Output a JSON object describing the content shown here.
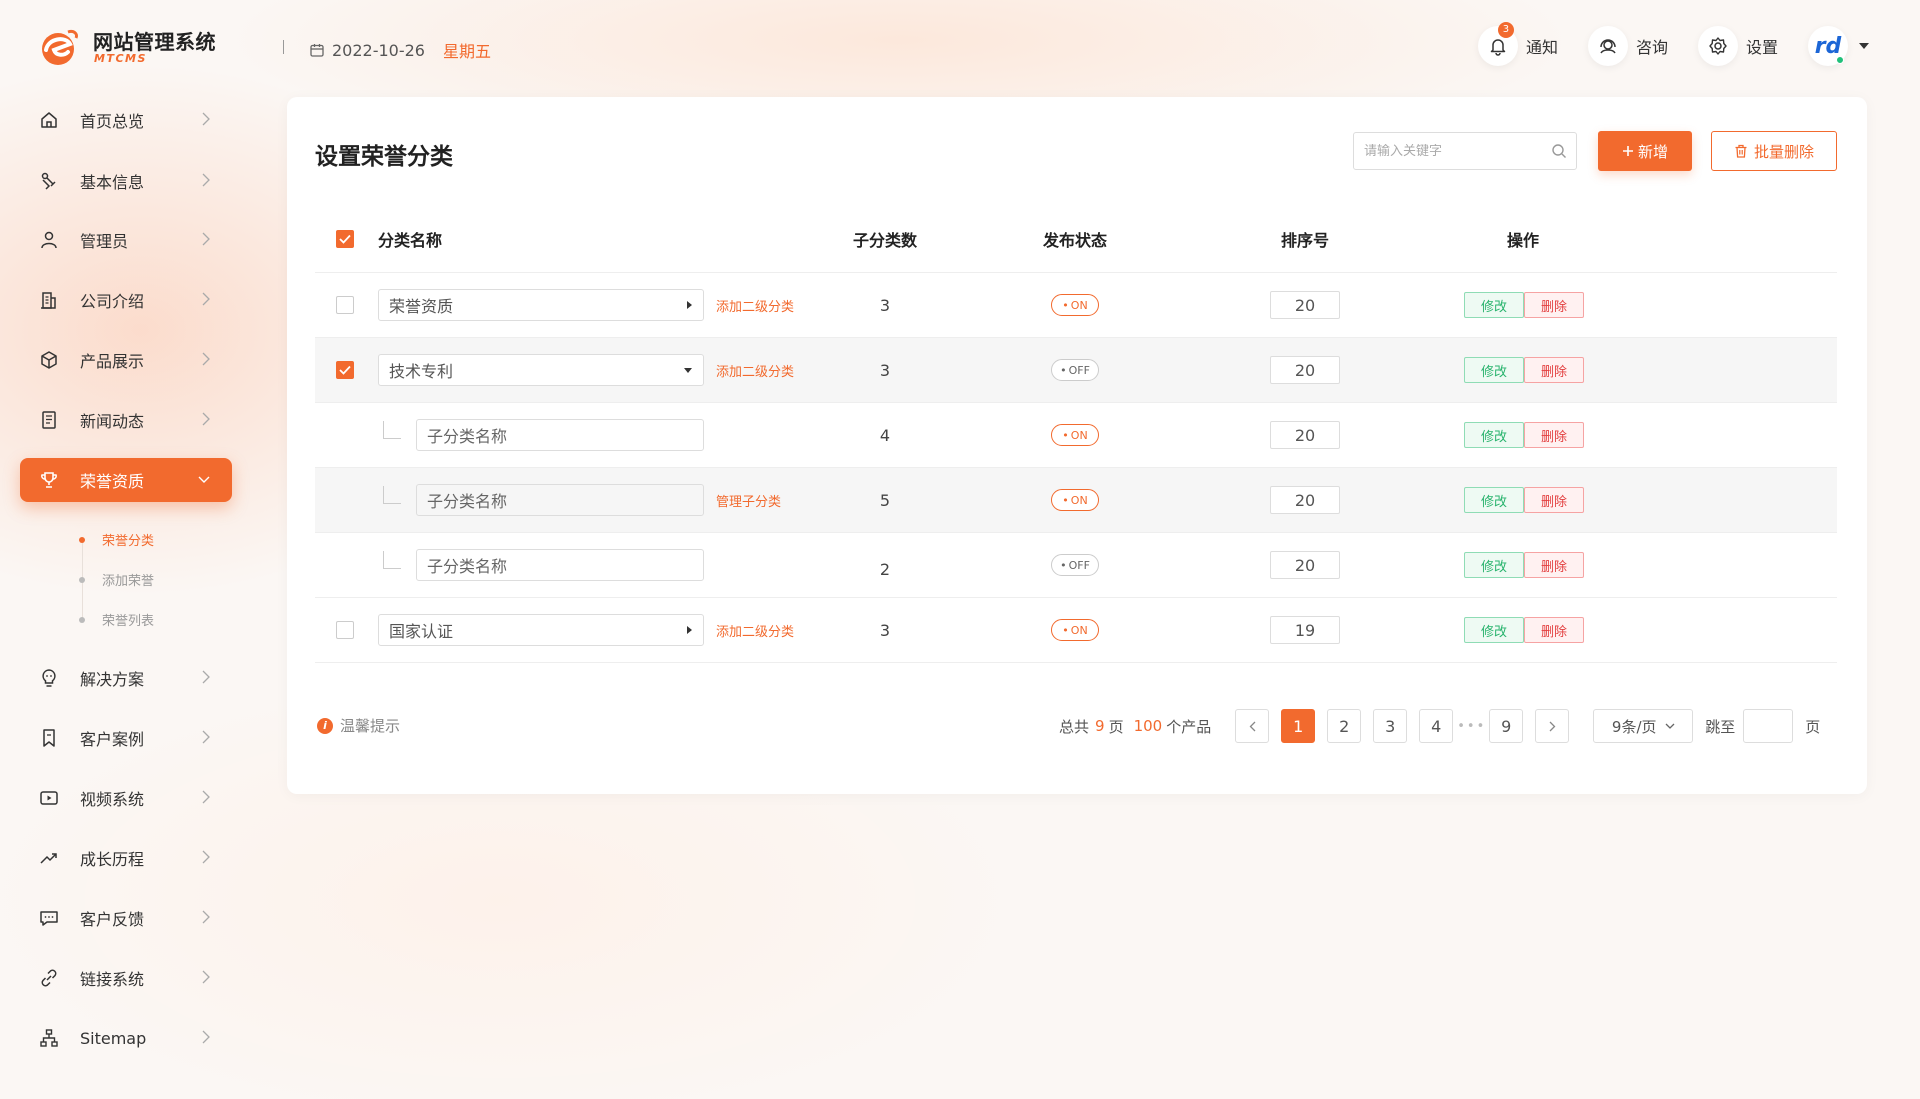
{
  "app": {
    "title": "网站管理系统",
    "subtitle": "MTCMS",
    "date": "2022-10-26",
    "weekday": "星期五"
  },
  "header": {
    "notify_label": "通知",
    "notify_count": "3",
    "consult_label": "咨询",
    "settings_label": "设置",
    "avatar_text": "rd"
  },
  "sidebar": {
    "items": [
      {
        "label": "首页总览",
        "icon": "home-icon"
      },
      {
        "label": "基本信息",
        "icon": "info-icon"
      },
      {
        "label": "管理员",
        "icon": "user-icon"
      },
      {
        "label": "公司介绍",
        "icon": "building-icon"
      },
      {
        "label": "产品展示",
        "icon": "box-icon"
      },
      {
        "label": "新闻动态",
        "icon": "news-icon"
      },
      {
        "label": "荣誉资质",
        "icon": "trophy-icon"
      },
      {
        "label": "解决方案",
        "icon": "bulb-icon"
      },
      {
        "label": "客户案例",
        "icon": "bookmark-icon"
      },
      {
        "label": "视频系统",
        "icon": "video-icon"
      },
      {
        "label": "成长历程",
        "icon": "trend-icon"
      },
      {
        "label": "客户反馈",
        "icon": "chat-icon"
      },
      {
        "label": "链接系统",
        "icon": "link-icon"
      },
      {
        "label": "Sitemap",
        "icon": "sitemap-icon"
      }
    ],
    "sub_items": [
      "荣誉分类",
      "添加荣誉",
      "荣誉列表"
    ]
  },
  "page": {
    "title": "设置荣誉分类",
    "search_placeholder": "请输入关键字",
    "add_label": "新增",
    "batch_delete_label": "批量删除"
  },
  "table": {
    "headers": {
      "name": "分类名称",
      "children": "子分类数",
      "status": "发布状态",
      "sort": "排序号",
      "ops": "操作"
    },
    "edit_label": "修改",
    "delete_label": "删除",
    "rows": [
      {
        "name": "荣誉资质",
        "link": "添加二级分类",
        "children": "3",
        "status": "ON",
        "sort": "20",
        "checked": false,
        "level": 1,
        "expanded": false
      },
      {
        "name": "技术专利",
        "link": "添加二级分类",
        "children": "3",
        "status": "OFF",
        "sort": "20",
        "checked": true,
        "level": 1,
        "expanded": true
      },
      {
        "name": "子分类名称",
        "link": "",
        "children": "4",
        "status": "ON",
        "sort": "20",
        "level": 2
      },
      {
        "name": "子分类名称",
        "link": "管理子分类",
        "children": "5",
        "status": "ON",
        "sort": "20",
        "level": 2
      },
      {
        "name": "子分类名称",
        "link": "",
        "children": "2",
        "status": "OFF",
        "sort": "20",
        "level": 2
      },
      {
        "name": "国家认证",
        "link": "添加二级分类",
        "children": "3",
        "status": "ON",
        "sort": "19",
        "checked": false,
        "level": 1,
        "expanded": false
      }
    ]
  },
  "footer": {
    "tip": "温馨提示",
    "total_prefix": "总共",
    "total_pages": "9",
    "pages_suffix": "页",
    "total_items": "100",
    "items_suffix": "个产品",
    "pages": [
      "1",
      "2",
      "3",
      "4",
      "9"
    ],
    "current_page": "1",
    "ellipsis": "•••",
    "page_size": "9条/页",
    "jump_label": "跳至",
    "jump_suffix": "页"
  },
  "colors": {
    "accent": "#f26a2e",
    "edit": "#27b36c",
    "delete": "#e33e3e"
  }
}
